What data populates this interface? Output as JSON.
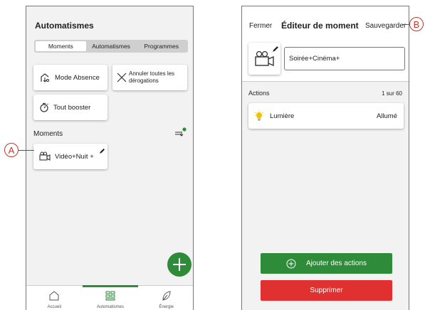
{
  "left": {
    "title": "Automatismes",
    "tabs": [
      {
        "label": "Moments",
        "active": true
      },
      {
        "label": "Automatismes",
        "active": false
      },
      {
        "label": "Programmes",
        "active": false
      }
    ],
    "cards": {
      "absence": "Mode Absence",
      "annuler": "Annuler toutes les dérogations",
      "booster": "Tout booster"
    },
    "moments_label": "Moments",
    "moment_item": "Vidéo+Nuit +",
    "nav": [
      {
        "label": "Accueil",
        "icon": "home-icon"
      },
      {
        "label": "Automatismes",
        "icon": "grid-icon"
      },
      {
        "label": "Énergie",
        "icon": "leaf-icon"
      }
    ]
  },
  "right": {
    "close": "Fermer",
    "title": "Éditeur de moment",
    "save": "Sauvegarder",
    "name_value": "Soirée+Cinéma+",
    "actions_label": "Actions",
    "actions_count": "1 sur 60",
    "action": {
      "label": "Lumière",
      "status": "Allumé"
    },
    "add_button": "Ajouter des actions",
    "delete_button": "Supprimer"
  },
  "callouts": {
    "a": "A",
    "b": "B"
  },
  "colors": {
    "green": "#2e8b3a",
    "red": "#e03030",
    "callout": "#c0392b"
  }
}
